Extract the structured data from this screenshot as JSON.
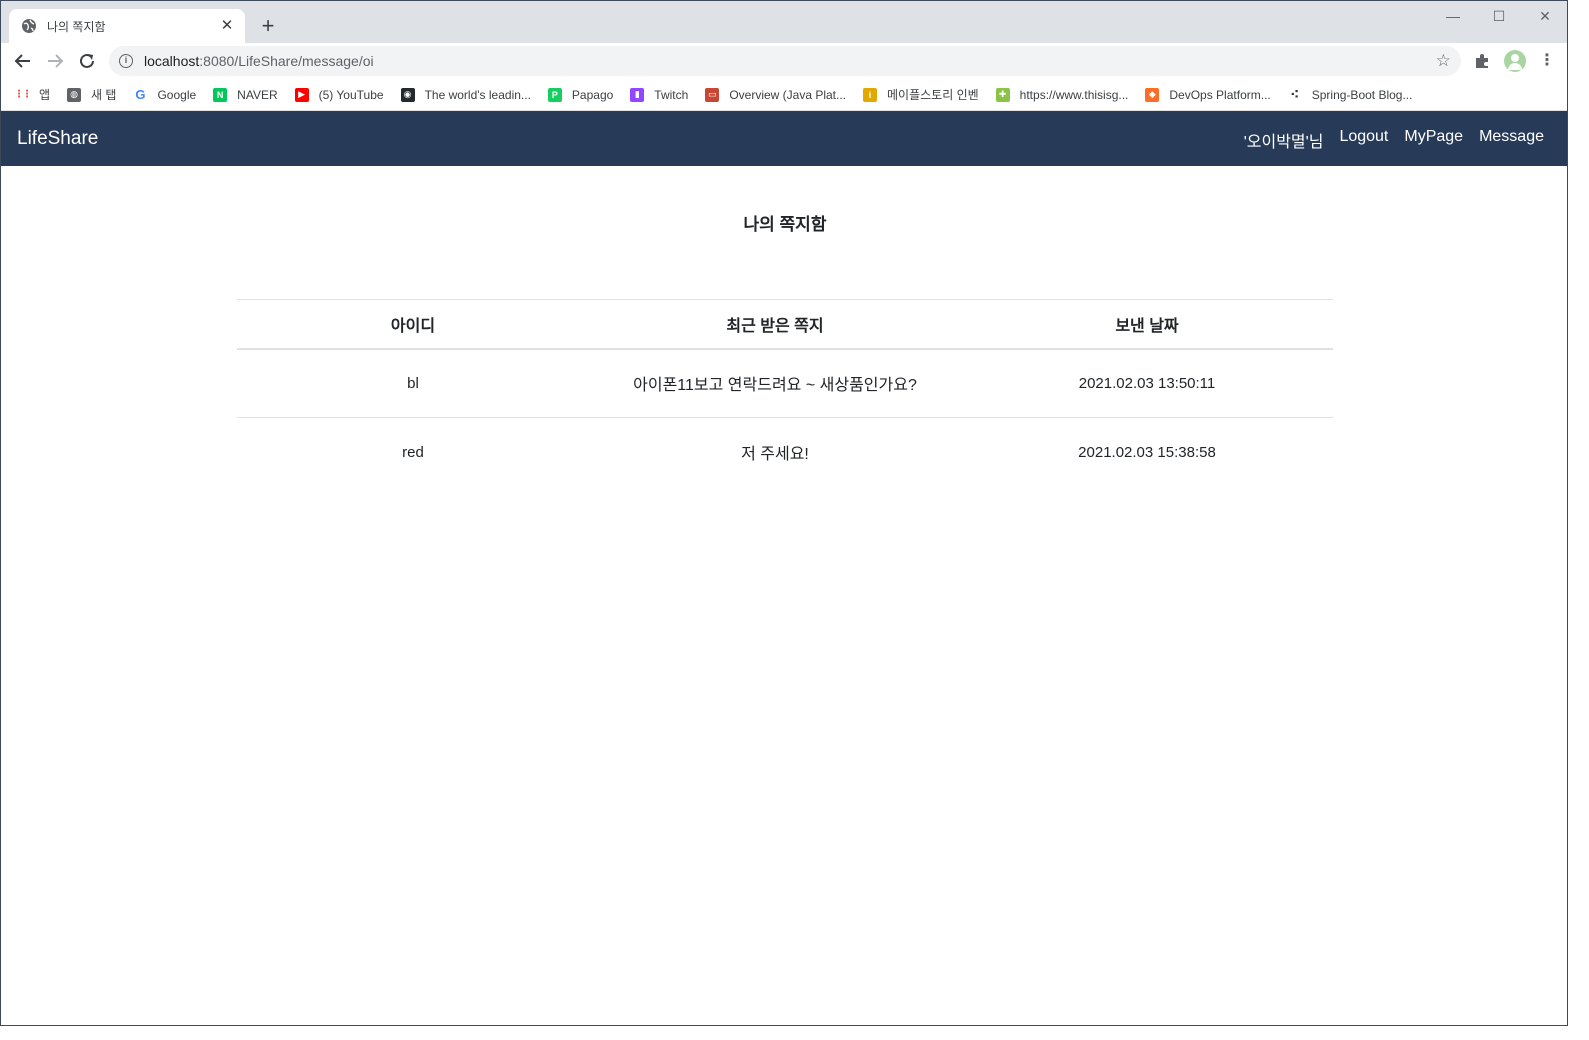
{
  "browser": {
    "tab_title": "나의 쪽지함",
    "url_host": "localhost",
    "url_rest": ":8080/LifeShare/message/oi",
    "bookmarks": [
      {
        "label": "앱",
        "icon": "apps-grid-icon",
        "color": "#4285f4"
      },
      {
        "label": "새 탭",
        "icon": "globe-icon",
        "color": "#5f6368"
      },
      {
        "label": "Google",
        "icon": "google-icon",
        "color": "#4285f4"
      },
      {
        "label": "NAVER",
        "icon": "naver-icon",
        "color": "#03c75a"
      },
      {
        "label": "(5) YouTube",
        "icon": "youtube-icon",
        "color": "#ff0000"
      },
      {
        "label": "The world's leadin...",
        "icon": "github-icon",
        "color": "#24292e"
      },
      {
        "label": "Papago",
        "icon": "papago-icon",
        "color": "#19ce60"
      },
      {
        "label": "Twitch",
        "icon": "twitch-icon",
        "color": "#9146ff"
      },
      {
        "label": "Overview (Java Plat...",
        "icon": "oracle-icon",
        "color": "#c74634"
      },
      {
        "label": "메이플스토리 인벤",
        "icon": "inven-icon",
        "color": "#e0a800"
      },
      {
        "label": "https://www.thisisg...",
        "icon": "puzzle-icon",
        "color": "#8bc34a"
      },
      {
        "label": "DevOps Platform...",
        "icon": "gitlab-icon",
        "color": "#fc6d26"
      },
      {
        "label": "Spring-Boot Blog...",
        "icon": "dots-icon",
        "color": "#333333"
      }
    ]
  },
  "navbar": {
    "brand": "LifeShare",
    "user": "'오이박멸'님",
    "logout": "Logout",
    "mypage": "MyPage",
    "message": "Message",
    "bg_color": "#273a58"
  },
  "main": {
    "heading": "나의 쪽지함",
    "columns": [
      "아이디",
      "최근 받은 쪽지",
      "보낸 날짜"
    ],
    "rows": [
      {
        "id": "bl",
        "message": "아이폰11보고 연락드려요 ~ 새상품인가요?",
        "date": "2021.02.03 13:50:11"
      },
      {
        "id": "red",
        "message": "저 주세요!",
        "date": "2021.02.03 15:38:58"
      }
    ]
  }
}
